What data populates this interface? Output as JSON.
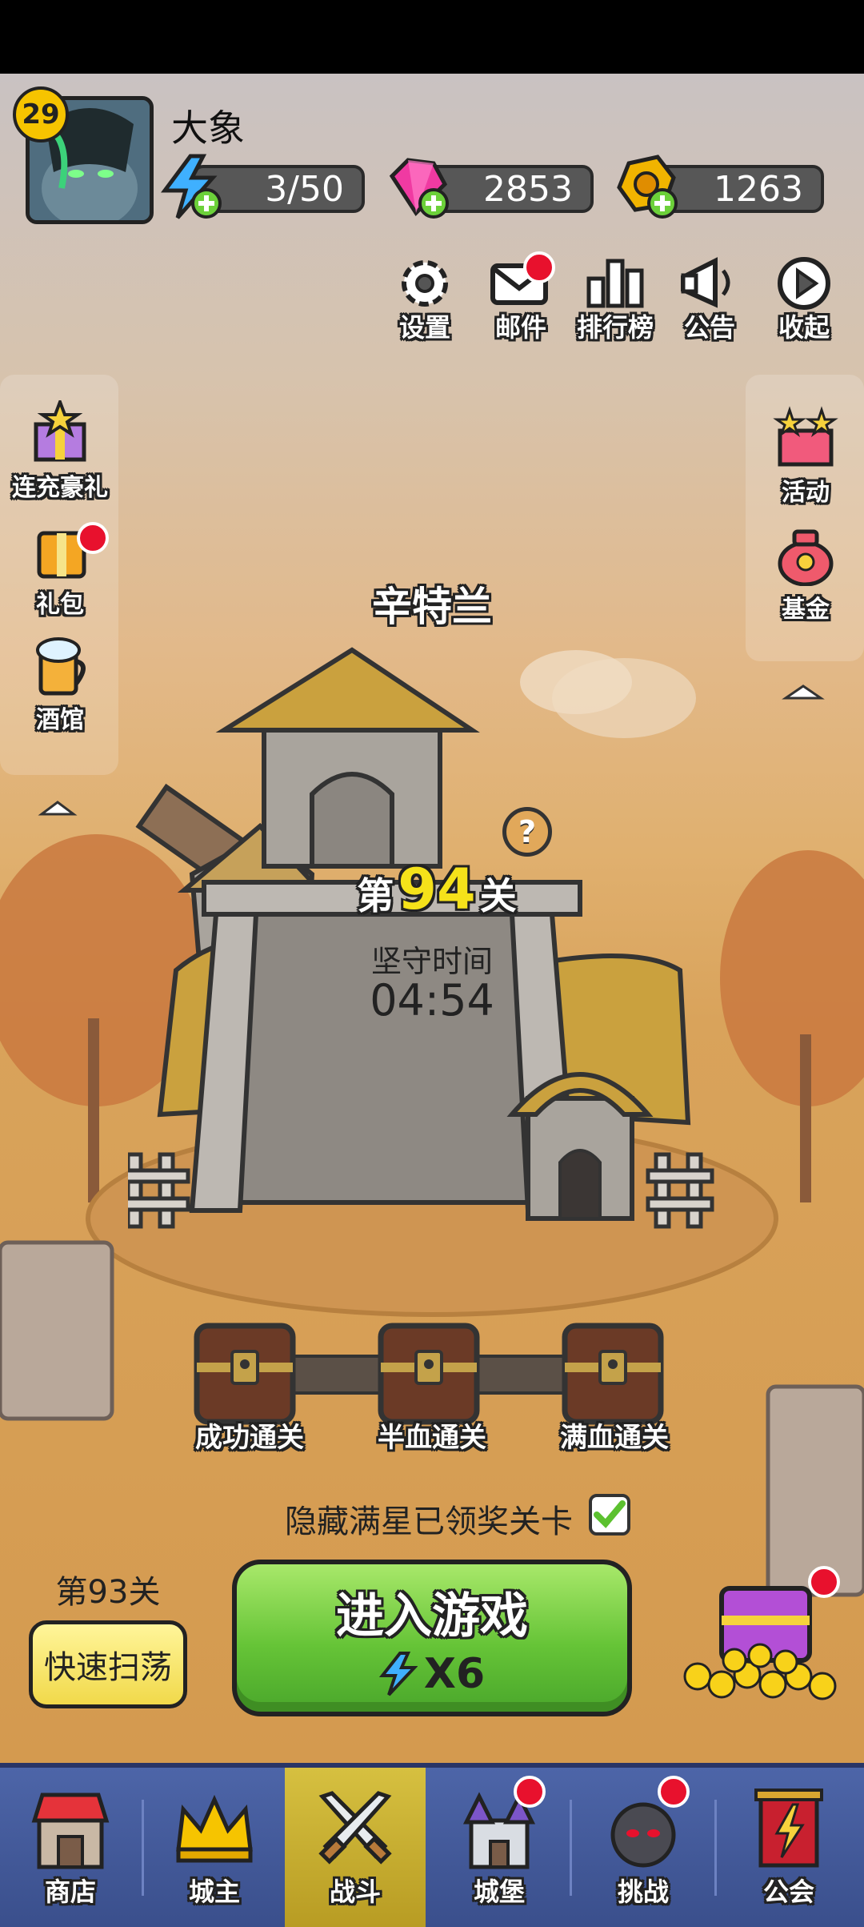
{
  "player": {
    "level": "29",
    "name": "大象"
  },
  "resources": {
    "energy": "3/50",
    "gems": "2853",
    "gold": "1263"
  },
  "top_menu": [
    {
      "label": "设置",
      "icon": "gear-icon"
    },
    {
      "label": "邮件",
      "icon": "mail-icon",
      "badge": true
    },
    {
      "label": "排行榜",
      "icon": "leaderboard-icon"
    },
    {
      "label": "公告",
      "icon": "megaphone-icon"
    },
    {
      "label": "收起",
      "icon": "collapse-play-icon"
    }
  ],
  "left_menu": [
    {
      "label": "连充豪礼",
      "icon": "gift-star-icon"
    },
    {
      "label": "礼包",
      "icon": "gift-pack-icon",
      "badge": true
    },
    {
      "label": "酒馆",
      "icon": "beer-mug-icon"
    }
  ],
  "right_menu": [
    {
      "label": "活动",
      "icon": "event-box-icon"
    },
    {
      "label": "基金",
      "icon": "money-bag-icon"
    }
  ],
  "stage": {
    "location": "辛特兰",
    "prefix": "第",
    "number": "94",
    "suffix": "关",
    "defend_label": "坚守时间",
    "defend_time": "04:54"
  },
  "chests": [
    {
      "label": "成功通关"
    },
    {
      "label": "半血通关"
    },
    {
      "label": "满血通关"
    }
  ],
  "hide_toggle": {
    "label": "隐藏满星已领奖关卡",
    "checked": true
  },
  "sweep": {
    "stage_label": "第93关",
    "button": "快速扫荡"
  },
  "enter_game": {
    "label": "进入游戏",
    "cost": "X6"
  },
  "bottom_nav": [
    {
      "label": "商店",
      "icon": "shop-icon"
    },
    {
      "label": "城主",
      "icon": "crown-icon"
    },
    {
      "label": "战斗",
      "icon": "crossed-swords-icon",
      "active": true
    },
    {
      "label": "城堡",
      "icon": "castle-icon",
      "badge": true
    },
    {
      "label": "挑战",
      "icon": "bomb-icon",
      "badge": true
    },
    {
      "label": "公会",
      "icon": "guild-banner-icon"
    }
  ],
  "colors": {
    "accent_green": "#66c437",
    "badge_red": "#e8112d",
    "nav_blue": "#3a4f8c",
    "active_gold": "#d6c040",
    "stage_yellow": "#f5e21a"
  }
}
